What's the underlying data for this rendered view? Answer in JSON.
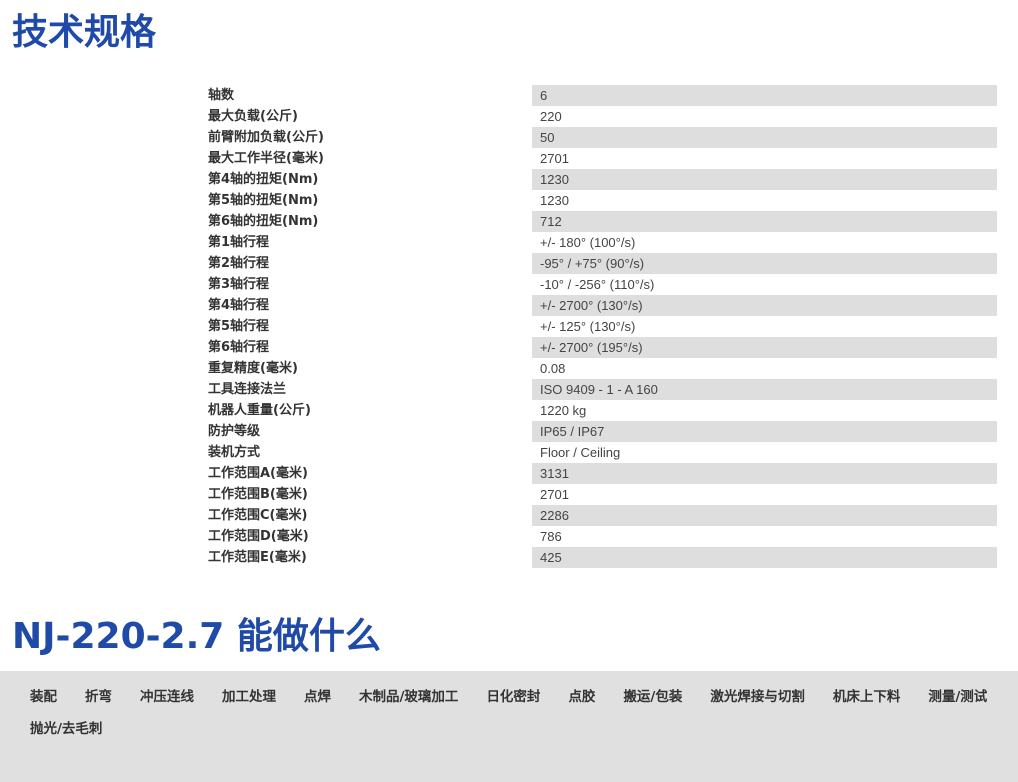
{
  "spec_section": {
    "title": "技术规格"
  },
  "specs": [
    {
      "label": "轴数",
      "value": "6"
    },
    {
      "label": "最大负载(公斤)",
      "value": "220"
    },
    {
      "label": "前臂附加负载(公斤)",
      "value": "50"
    },
    {
      "label": "最大工作半径(毫米)",
      "value": "2701"
    },
    {
      "label": "第4轴的扭矩(Nm)",
      "value": "1230"
    },
    {
      "label": "第5轴的扭矩(Nm)",
      "value": "1230"
    },
    {
      "label": "第6轴的扭矩(Nm)",
      "value": "712"
    },
    {
      "label": "第1轴行程",
      "value": "+/- 180° (100°/s)"
    },
    {
      "label": "第2轴行程",
      "value": "-95° / +75° (90°/s)"
    },
    {
      "label": "第3轴行程",
      "value": "-10° / -256° (110°/s)"
    },
    {
      "label": "第4轴行程",
      "value": "+/- 2700° (130°/s)"
    },
    {
      "label": "第5轴行程",
      "value": "+/- 125° (130°/s)"
    },
    {
      "label": "第6轴行程",
      "value": "+/- 2700° (195°/s)"
    },
    {
      "label": "重复精度(毫米)",
      "value": "0.08"
    },
    {
      "label": "工具连接法兰",
      "value": "ISO 9409 - 1 - A 160"
    },
    {
      "label": "机器人重量(公斤)",
      "value": "1220 kg"
    },
    {
      "label": "防护等级",
      "value": "IP65 / IP67"
    },
    {
      "label": "装机方式",
      "value": "Floor / Ceiling"
    },
    {
      "label": "工作范围A(毫米)",
      "value": "3131"
    },
    {
      "label": "工作范围B(毫米)",
      "value": "2701"
    },
    {
      "label": "工作范围C(毫米)",
      "value": "2286"
    },
    {
      "label": "工作范围D(毫米)",
      "value": "786"
    },
    {
      "label": "工作范围E(毫米)",
      "value": "425"
    }
  ],
  "apps_section": {
    "title": "NJ-220-2.7 能做什么"
  },
  "applications": [
    "装配",
    "折弯",
    "冲压连线",
    "加工处理",
    "点焊",
    "木制品/玻璃加工",
    "日化密封",
    "点胶",
    "搬运/包装",
    "激光焊接与切割",
    "机床上下料",
    "测量/测试",
    "抛光/去毛刺"
  ],
  "colors": {
    "title_blue": "#1f4aa8",
    "stripe_gray": "#dedede",
    "panel_gray": "#e0e0e0"
  }
}
